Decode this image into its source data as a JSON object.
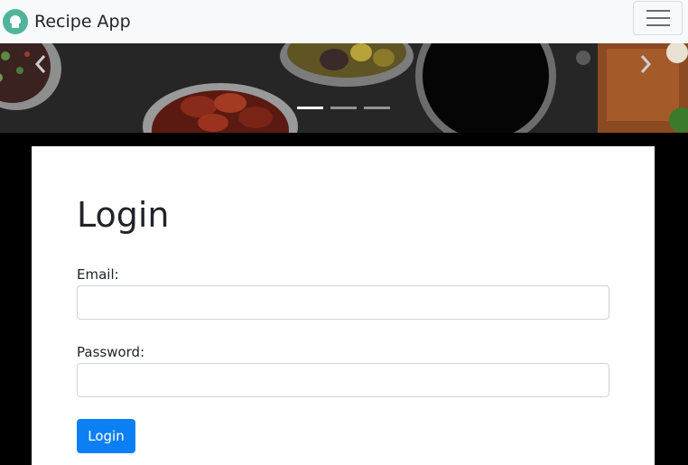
{
  "navbar": {
    "brand_text": "Recipe App",
    "logo_icon": "chef-hat-icon",
    "toggler_icon": "hamburger-menu-icon"
  },
  "carousel": {
    "prev_icon": "chevron-left-icon",
    "next_icon": "chevron-right-icon",
    "slide_count": 3,
    "active_slide": 1
  },
  "login": {
    "title": "Login",
    "email_label": "Email:",
    "email_value": "",
    "password_label": "Password:",
    "password_value": "",
    "submit_label": "Login"
  },
  "colors": {
    "brand_logo": "#4fb49a",
    "primary_button": "#0d7ff5",
    "navbar_bg": "#f8f9fa",
    "page_bg": "#000000"
  }
}
